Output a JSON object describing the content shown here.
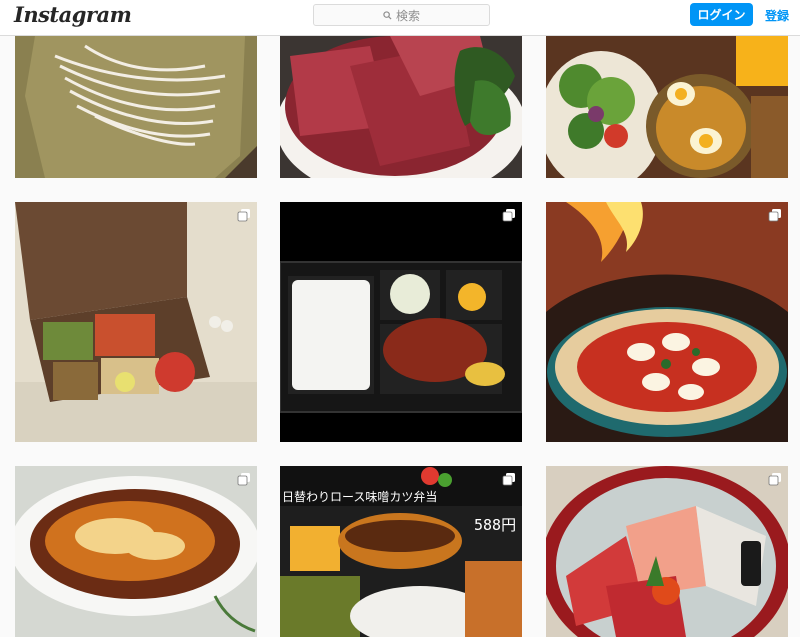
{
  "header": {
    "logo_text": "Instagram",
    "search_placeholder": "検索",
    "login_label": "ログイン",
    "signup_label": "登録"
  },
  "colors": {
    "accent": "#0095f6",
    "background": "#fafafa",
    "border": "#dbdbdb"
  },
  "posts": [
    {
      "subject": "udon noodles on plate",
      "multi": false
    },
    {
      "subject": "sliced beef steak bowl",
      "multi": false
    },
    {
      "subject": "salad and curry set",
      "multi": false
    },
    {
      "subject": "bento box in brown case",
      "multi": true
    },
    {
      "subject": "tonkatsu rice bento",
      "multi": true
    },
    {
      "subject": "margherita pizza by oven",
      "multi": true
    },
    {
      "subject": "omurice with demi-glace",
      "multi": true
    },
    {
      "subject": "katsu bento",
      "multi": true,
      "overlay_text": "日替わりロース味噌カツ弁当",
      "price_text": "588円"
    },
    {
      "subject": "kaisendon seafood bowl",
      "multi": true
    }
  ]
}
